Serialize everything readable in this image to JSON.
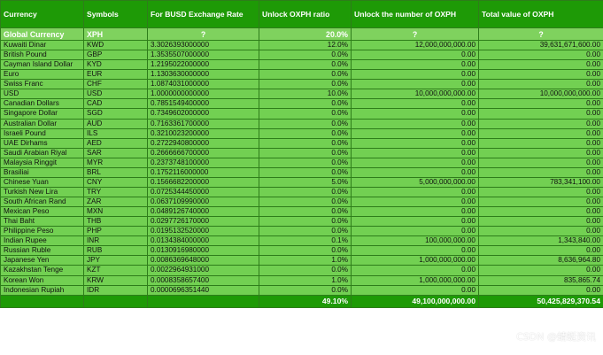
{
  "headers": [
    "Currency",
    "Symbols",
    "For BUSD Exchange Rate",
    "Unlock OXPH ratio",
    "Unlock the number of OXPH",
    "Total value of OXPH"
  ],
  "global_row": [
    "Global Currency",
    "XPH",
    "?",
    "20.0%",
    "?",
    "?"
  ],
  "rows": [
    [
      "Kuwaiti Dinar",
      "KWD",
      "3.3026393000000",
      "12.0%",
      "12,000,000,000.00",
      "39,631,671,600.00"
    ],
    [
      "British Pound",
      "GBP",
      "1.3535507000000",
      "0.0%",
      "0.00",
      "0.00"
    ],
    [
      "Cayman Island Dollar",
      "KYD",
      "1.2195022000000",
      "0.0%",
      "0.00",
      "0.00"
    ],
    [
      "Euro",
      "EUR",
      "1.1303630000000",
      "0.0%",
      "0.00",
      "0.00"
    ],
    [
      "Swiss Franc",
      "CHF",
      "1.0874031000000",
      "0.0%",
      "0.00",
      "0.00"
    ],
    [
      "USD",
      "USD",
      "1.0000000000000",
      "10.0%",
      "10,000,000,000.00",
      "10,000,000,000.00"
    ],
    [
      "Canadian Dollars",
      "CAD",
      "0.7851549400000",
      "0.0%",
      "0.00",
      "0.00"
    ],
    [
      "Singapore Dollar",
      "SGD",
      "0.7349602000000",
      "0.0%",
      "0.00",
      "0.00"
    ],
    [
      "Australian Dollar",
      "AUD",
      "0.7163361700000",
      "0.0%",
      "0.00",
      "0.00"
    ],
    [
      "Israeli Pound",
      "ILS",
      "0.3210023200000",
      "0.0%",
      "0.00",
      "0.00"
    ],
    [
      "UAE Dirhams",
      "AED",
      "0.2722940800000",
      "0.0%",
      "0.00",
      "0.00"
    ],
    [
      "Saudi Arabian Riyal",
      "SAR",
      "0.2666666700000",
      "0.0%",
      "0.00",
      "0.00"
    ],
    [
      "Malaysia Ringgit",
      "MYR",
      "0.2373748100000",
      "0.0%",
      "0.00",
      "0.00"
    ],
    [
      "Brasiliai",
      "BRL",
      "0.1752116000000",
      "0.0%",
      "0.00",
      "0.00"
    ],
    [
      "Chinese Yuan",
      "CNY",
      "0.1566682200000",
      "5.0%",
      "5,000,000,000.00",
      "783,341,100.00"
    ],
    [
      "Turkish New Lira",
      "TRY",
      "0.0725344450000",
      "0.0%",
      "0.00",
      "0.00"
    ],
    [
      "South African Rand",
      "ZAR",
      "0.0637109990000",
      "0.0%",
      "0.00",
      "0.00"
    ],
    [
      "Mexican Peso",
      "MXN",
      "0.0489126740000",
      "0.0%",
      "0.00",
      "0.00"
    ],
    [
      "Thai Baht",
      "THB",
      "0.0297726170000",
      "0.0%",
      "0.00",
      "0.00"
    ],
    [
      "Philippine Peso",
      "PHP",
      "0.0195132520000",
      "0.0%",
      "0.00",
      "0.00"
    ],
    [
      "Indian Rupee",
      "INR",
      "0.0134384000000",
      "0.1%",
      "100,000,000.00",
      "1,343,840.00"
    ],
    [
      "Russian Ruble",
      "RUB",
      "0.0130916980000",
      "0.0%",
      "0.00",
      "0.00"
    ],
    [
      "Japanese Yen",
      "JPY",
      "0.0086369648000",
      "1.0%",
      "1,000,000,000.00",
      "8,636,964.80"
    ],
    [
      "Kazakhstan Tenge",
      "KZT",
      "0.0022964931000",
      "0.0%",
      "0.00",
      "0.00"
    ],
    [
      "Korean Won",
      "KRW",
      "0.0008358657400",
      "1.0%",
      "1,000,000,000.00",
      "835,865.74"
    ],
    [
      "Indonesian Rupiah",
      "IDR",
      "0.0000696351440",
      "0.0%",
      "0.00",
      "0.00"
    ]
  ],
  "total_row": [
    "",
    "",
    "",
    "49.10%",
    "49,100,000,000.00",
    "50,425,829,370.54"
  ],
  "watermark": "CSDN @蜻蜓资讯"
}
